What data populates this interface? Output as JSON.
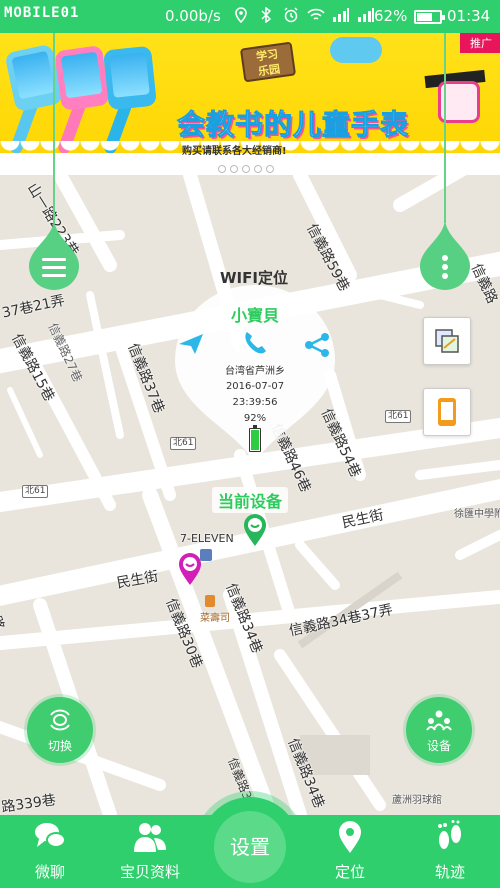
{
  "status_bar": {
    "brand": "MOBILE01",
    "rate": "0.00b/s",
    "battery_pct": "62%",
    "battery_level": 0.62,
    "time": "01:34",
    "color": "#2ecf6c"
  },
  "banner": {
    "ad_tag": "推广",
    "headline": "会教书的儿童手表",
    "subtitle": "购买请联系各大经销商!",
    "sign_line1": "学习",
    "sign_line2": "乐园",
    "dots_count": 5
  },
  "map": {
    "popup_title": "WIFI定位",
    "device_name": "小寶貝",
    "address": "台湾省芦洲乡",
    "date": "2016-07-07",
    "clock": "23:39:56",
    "battery": "92%",
    "battery_level": 0.92,
    "current_device_label": "当前设备",
    "poi_seven": "7-ELEVEN",
    "poi_sushi": "菜壽司",
    "poi_badminton": "蘆洲羽球館",
    "poi_gym": "徐匯中學附",
    "roads": {
      "r1": "山一路223巷",
      "r2": "37巷21弄",
      "r3": "信義路27巷",
      "r4": "信義路15巷",
      "r5": "信義路37巷",
      "r6": "信義路59巷",
      "r7": "信義路46巷",
      "r8": "信義路54巷",
      "r9": "民生街",
      "r10": "民生街",
      "r11": "信義路30巷",
      "r12": "信義路34巷",
      "r13": "信義路34巷37弄",
      "r14": "信義路34巷",
      "r15": "路339巷",
      "r16": "功路",
      "r17": "信義路"
    },
    "shields": [
      "北61",
      "北61",
      "北61",
      "北61"
    ],
    "switch_label": "切换",
    "device_btn_label": "设备"
  },
  "bottom_nav": {
    "items": [
      {
        "label": "微聊",
        "icon": "chat-icon"
      },
      {
        "label": "宝贝资料",
        "icon": "people-icon"
      },
      {
        "label": "定位",
        "icon": "location-pin-icon"
      },
      {
        "label": "轨迹",
        "icon": "footprint-icon"
      }
    ],
    "settings_label": "设置",
    "accent": "#2ecf6c"
  }
}
